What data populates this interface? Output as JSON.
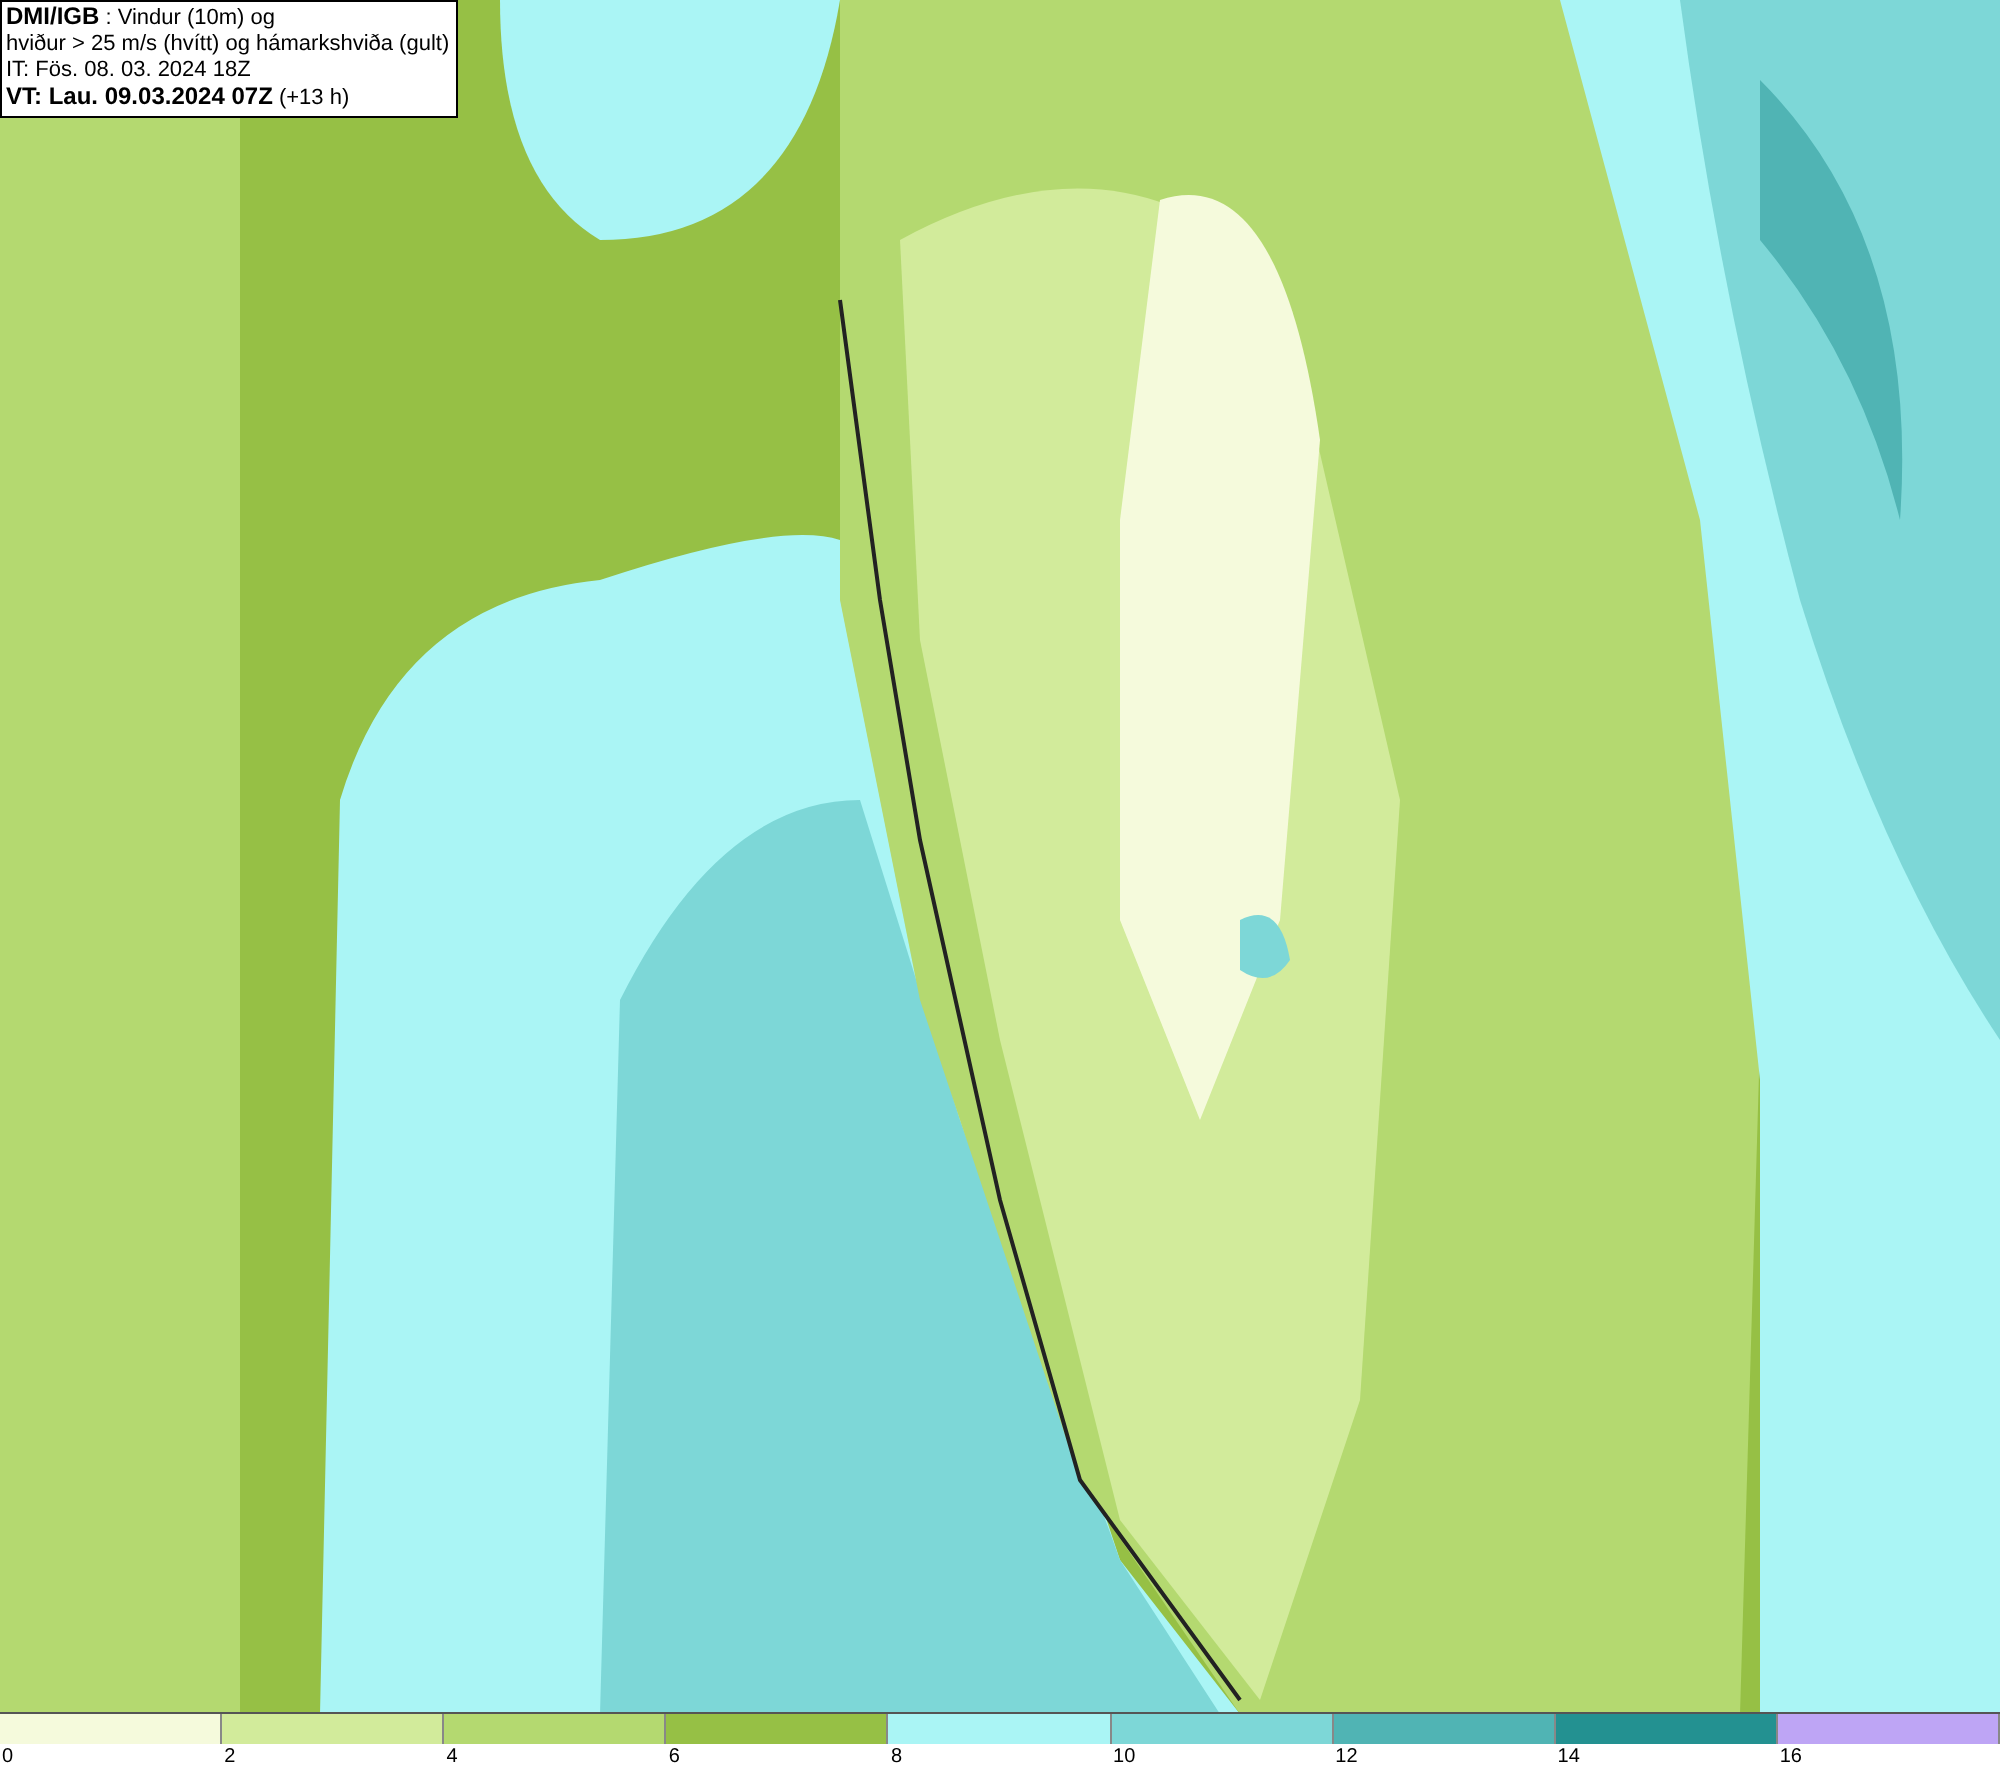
{
  "info_box": {
    "lines": [
      "**DMI/IGB** : Vindur (10m) og",
      "hviður > 25 m/s (hvítt) og hámarkshviða (gult)",
      "IT: Fös. 08. 03. 2024 18Z",
      "**VT: Lau. 09.03.2024 07Z** (+13 h)"
    ]
  },
  "legend": {
    "bins": [
      {
        "color": "#f5fadc",
        "label": "0"
      },
      {
        "color": "#d2eb9b",
        "label": "2"
      },
      {
        "color": "#b4d970",
        "label": "4"
      },
      {
        "color": "#96c045",
        "label": "6"
      },
      {
        "color": "#aaf5f5",
        "label": "8"
      },
      {
        "color": "#7dd7d7",
        "label": "10"
      },
      {
        "color": "#50b4b4",
        "label": "12"
      },
      {
        "color": "#239191",
        "label": "14"
      },
      {
        "color": "#bea5f5",
        "label": "16"
      }
    ]
  }
}
